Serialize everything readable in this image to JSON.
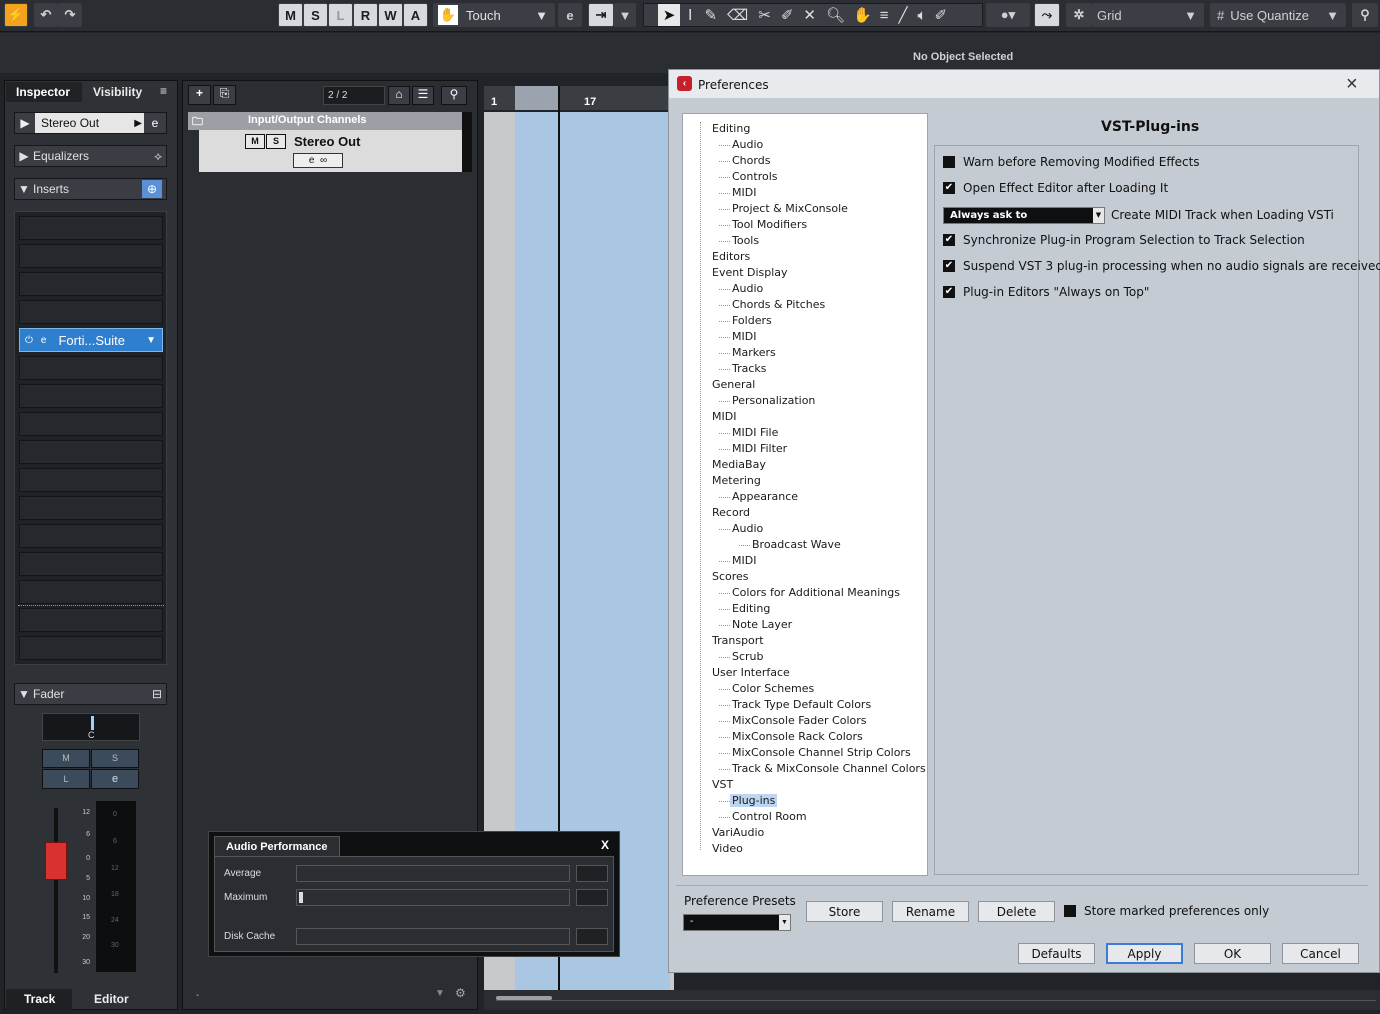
{
  "toolbar": {
    "modes": [
      "M",
      "S",
      "L",
      "R",
      "W",
      "A"
    ],
    "automation_mode": "Touch",
    "snap_type": "Grid",
    "quantize": "Use Quantize"
  },
  "info_line": "No Object Selected",
  "inspector": {
    "tabs": [
      "Inspector",
      "Visibility"
    ],
    "channel": "Stereo Out",
    "sections": {
      "equalizers": "Equalizers",
      "inserts": "Inserts",
      "fader": "Fader"
    },
    "insert_plugin": "Forti...Suite",
    "fader_pan": "C",
    "fader_buttons": [
      "M",
      "S",
      "L"
    ],
    "scale_left": [
      "12",
      "6",
      "0",
      "5",
      "10",
      "15",
      "20",
      "30"
    ],
    "scale_right": [
      "0",
      "6",
      "12",
      "18",
      "24",
      "30"
    ],
    "bottom_tabs": [
      "Track",
      "Editor"
    ]
  },
  "project": {
    "track_count": "2 / 2",
    "folder": "Input/Output Channels",
    "track_name": "Stereo Out",
    "track_ms": [
      "M",
      "S"
    ],
    "ruler": [
      "1",
      "17"
    ]
  },
  "audio_performance": {
    "title": "Audio Performance",
    "close": "X",
    "labels": [
      "Average",
      "Maximum",
      "Disk Cache"
    ]
  },
  "preferences": {
    "title": "Preferences",
    "page_title": "VST-Plug-ins",
    "tree": [
      {
        "label": "Editing",
        "level": 0
      },
      {
        "label": "Audio",
        "level": 1
      },
      {
        "label": "Chords",
        "level": 1
      },
      {
        "label": "Controls",
        "level": 1
      },
      {
        "label": "MIDI",
        "level": 1
      },
      {
        "label": "Project & MixConsole",
        "level": 1
      },
      {
        "label": "Tool Modifiers",
        "level": 1
      },
      {
        "label": "Tools",
        "level": 1
      },
      {
        "label": "Editors",
        "level": 0
      },
      {
        "label": "Event Display",
        "level": 0
      },
      {
        "label": "Audio",
        "level": 1
      },
      {
        "label": "Chords & Pitches",
        "level": 1
      },
      {
        "label": "Folders",
        "level": 1
      },
      {
        "label": "MIDI",
        "level": 1
      },
      {
        "label": "Markers",
        "level": 1
      },
      {
        "label": "Tracks",
        "level": 1
      },
      {
        "label": "General",
        "level": 0
      },
      {
        "label": "Personalization",
        "level": 1
      },
      {
        "label": "MIDI",
        "level": 0
      },
      {
        "label": "MIDI File",
        "level": 1
      },
      {
        "label": "MIDI Filter",
        "level": 1
      },
      {
        "label": "MediaBay",
        "level": 0
      },
      {
        "label": "Metering",
        "level": 0
      },
      {
        "label": "Appearance",
        "level": 1
      },
      {
        "label": "Record",
        "level": 0
      },
      {
        "label": "Audio",
        "level": 1
      },
      {
        "label": "Broadcast Wave",
        "level": 2
      },
      {
        "label": "MIDI",
        "level": 1
      },
      {
        "label": "Scores",
        "level": 0
      },
      {
        "label": "Colors for Additional Meanings",
        "level": 1
      },
      {
        "label": "Editing",
        "level": 1
      },
      {
        "label": "Note Layer",
        "level": 1
      },
      {
        "label": "Transport",
        "level": 0
      },
      {
        "label": "Scrub",
        "level": 1
      },
      {
        "label": "User Interface",
        "level": 0
      },
      {
        "label": "Color Schemes",
        "level": 1
      },
      {
        "label": "Track Type Default Colors",
        "level": 1
      },
      {
        "label": "MixConsole Fader Colors",
        "level": 1
      },
      {
        "label": "MixConsole Rack Colors",
        "level": 1
      },
      {
        "label": "MixConsole Channel Strip Colors",
        "level": 1
      },
      {
        "label": "Track & MixConsole Channel Colors",
        "level": 1
      },
      {
        "label": "VST",
        "level": 0
      },
      {
        "label": "Plug-ins",
        "level": 1,
        "selected": true
      },
      {
        "label": "Control Room",
        "level": 1
      },
      {
        "label": "VariAudio",
        "level": 0
      },
      {
        "label": "Video",
        "level": 0
      }
    ],
    "options": [
      {
        "label": "Warn before Removing Modified Effects",
        "checked": false
      },
      {
        "label": "Open Effect Editor after Loading It",
        "checked": true
      },
      {
        "label": "Create MIDI Track when Loading VSTi",
        "dropdown": "Always ask to"
      },
      {
        "label": "Synchronize Plug-in Program Selection to Track Selection",
        "checked": true
      },
      {
        "label": "Suspend VST 3 plug-in processing when no audio signals are received",
        "checked": true
      },
      {
        "label": "Plug-in Editors \"Always on Top\"",
        "checked": true
      }
    ],
    "presets_label": "Preference Presets",
    "presets_value": "-",
    "store": "Store",
    "rename": "Rename",
    "delete": "Delete",
    "store_marked": "Store marked preferences only",
    "buttons": {
      "defaults": "Defaults",
      "apply": "Apply",
      "ok": "OK",
      "cancel": "Cancel"
    },
    "close": "×",
    "check_glyph": "✔"
  }
}
